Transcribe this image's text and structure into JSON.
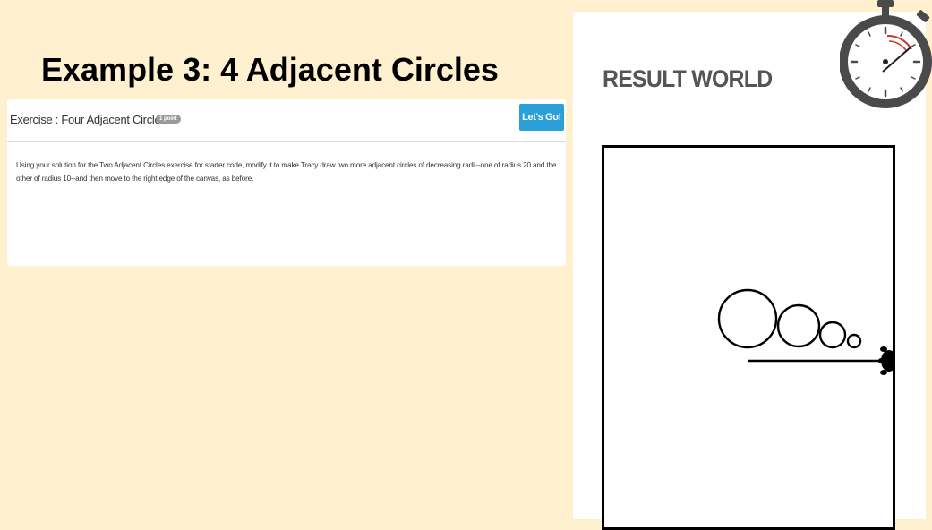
{
  "slide": {
    "title_prefix": "Example 3: ",
    "title_bold": "4 Adjacent Circles"
  },
  "exercise": {
    "title": "Exercise : Four Adjacent Circles",
    "badge": "1 point",
    "button_label": "Let's Go!",
    "description": "Using your solution for the Two Adjacent Circles exercise for starter code, modify it to make Tracy draw two more adjacent circles of decreasing radii--one of radius 20 and the other of radius 10--and then move to the right edge of the canvas, as before."
  },
  "result": {
    "title": "RESULT WORLD"
  },
  "icons": {
    "timer": "stopwatch-icon",
    "turtle": "turtle-icon"
  },
  "colors": {
    "background": "#fff0cf",
    "button": "#2a9fd8",
    "badge": "#9a9a9a",
    "stopwatch": "#4a4a4a",
    "stopwatch_hand": "#c0392b"
  }
}
